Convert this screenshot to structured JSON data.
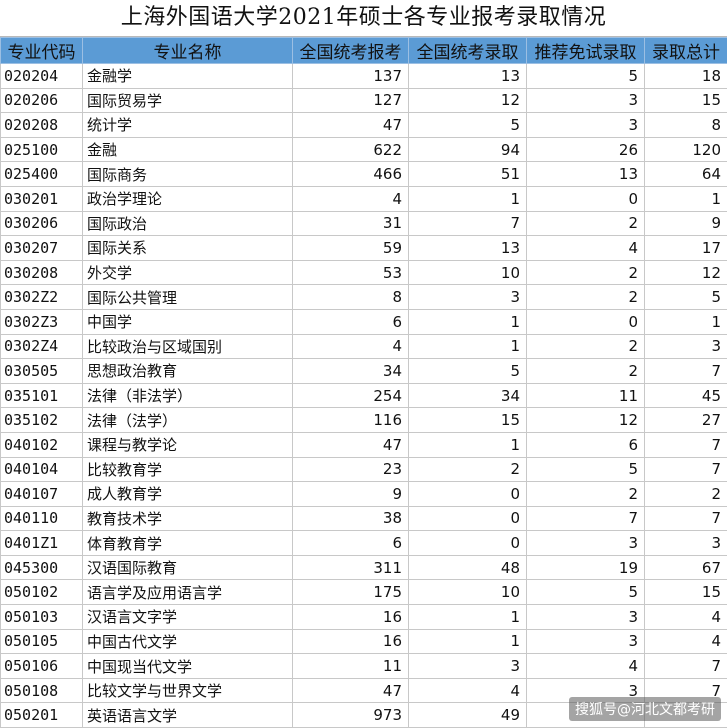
{
  "title": "上海外国语大学2021年硕士各专业报考录取情况",
  "columns": [
    "专业代码",
    "专业名称",
    "全国统考报考",
    "全国统考录取",
    "推荐免试录取",
    "录取总计"
  ],
  "rows": [
    [
      "020204",
      "金融学",
      "137",
      "13",
      "5",
      "18"
    ],
    [
      "020206",
      "国际贸易学",
      "127",
      "12",
      "3",
      "15"
    ],
    [
      "020208",
      "统计学",
      "47",
      "5",
      "3",
      "8"
    ],
    [
      "025100",
      "金融",
      "622",
      "94",
      "26",
      "120"
    ],
    [
      "025400",
      "国际商务",
      "466",
      "51",
      "13",
      "64"
    ],
    [
      "030201",
      "政治学理论",
      "4",
      "1",
      "0",
      "1"
    ],
    [
      "030206",
      "国际政治",
      "31",
      "7",
      "2",
      "9"
    ],
    [
      "030207",
      "国际关系",
      "59",
      "13",
      "4",
      "17"
    ],
    [
      "030208",
      "外交学",
      "53",
      "10",
      "2",
      "12"
    ],
    [
      "0302Z2",
      "国际公共管理",
      "8",
      "3",
      "2",
      "5"
    ],
    [
      "0302Z3",
      "中国学",
      "6",
      "1",
      "0",
      "1"
    ],
    [
      "0302Z4",
      "比较政治与区域国别",
      "4",
      "1",
      "2",
      "3"
    ],
    [
      "030505",
      "思想政治教育",
      "34",
      "5",
      "2",
      "7"
    ],
    [
      "035101",
      "法律（非法学）",
      "254",
      "34",
      "11",
      "45"
    ],
    [
      "035102",
      "法律（法学）",
      "116",
      "15",
      "12",
      "27"
    ],
    [
      "040102",
      "课程与教学论",
      "47",
      "1",
      "6",
      "7"
    ],
    [
      "040104",
      "比较教育学",
      "23",
      "2",
      "5",
      "7"
    ],
    [
      "040107",
      "成人教育学",
      "9",
      "0",
      "2",
      "2"
    ],
    [
      "040110",
      "教育技术学",
      "38",
      "0",
      "7",
      "7"
    ],
    [
      "0401Z1",
      "体育教育学",
      "6",
      "0",
      "3",
      "3"
    ],
    [
      "045300",
      "汉语国际教育",
      "311",
      "48",
      "19",
      "67"
    ],
    [
      "050102",
      "语言学及应用语言学",
      "175",
      "10",
      "5",
      "15"
    ],
    [
      "050103",
      "汉语言文字学",
      "16",
      "1",
      "3",
      "4"
    ],
    [
      "050105",
      "中国古代文学",
      "16",
      "1",
      "3",
      "4"
    ],
    [
      "050106",
      "中国现当代文学",
      "11",
      "3",
      "4",
      "7"
    ],
    [
      "050108",
      "比较文学与世界文学",
      "47",
      "4",
      "3",
      "7"
    ],
    [
      "050201",
      "英语语言文学",
      "973",
      "49",
      "",
      ""
    ]
  ],
  "watermark": "搜狐号@河北文都考研",
  "colors": {
    "header_bg": "#5b9bd5",
    "grid": "#c8c8c8"
  }
}
